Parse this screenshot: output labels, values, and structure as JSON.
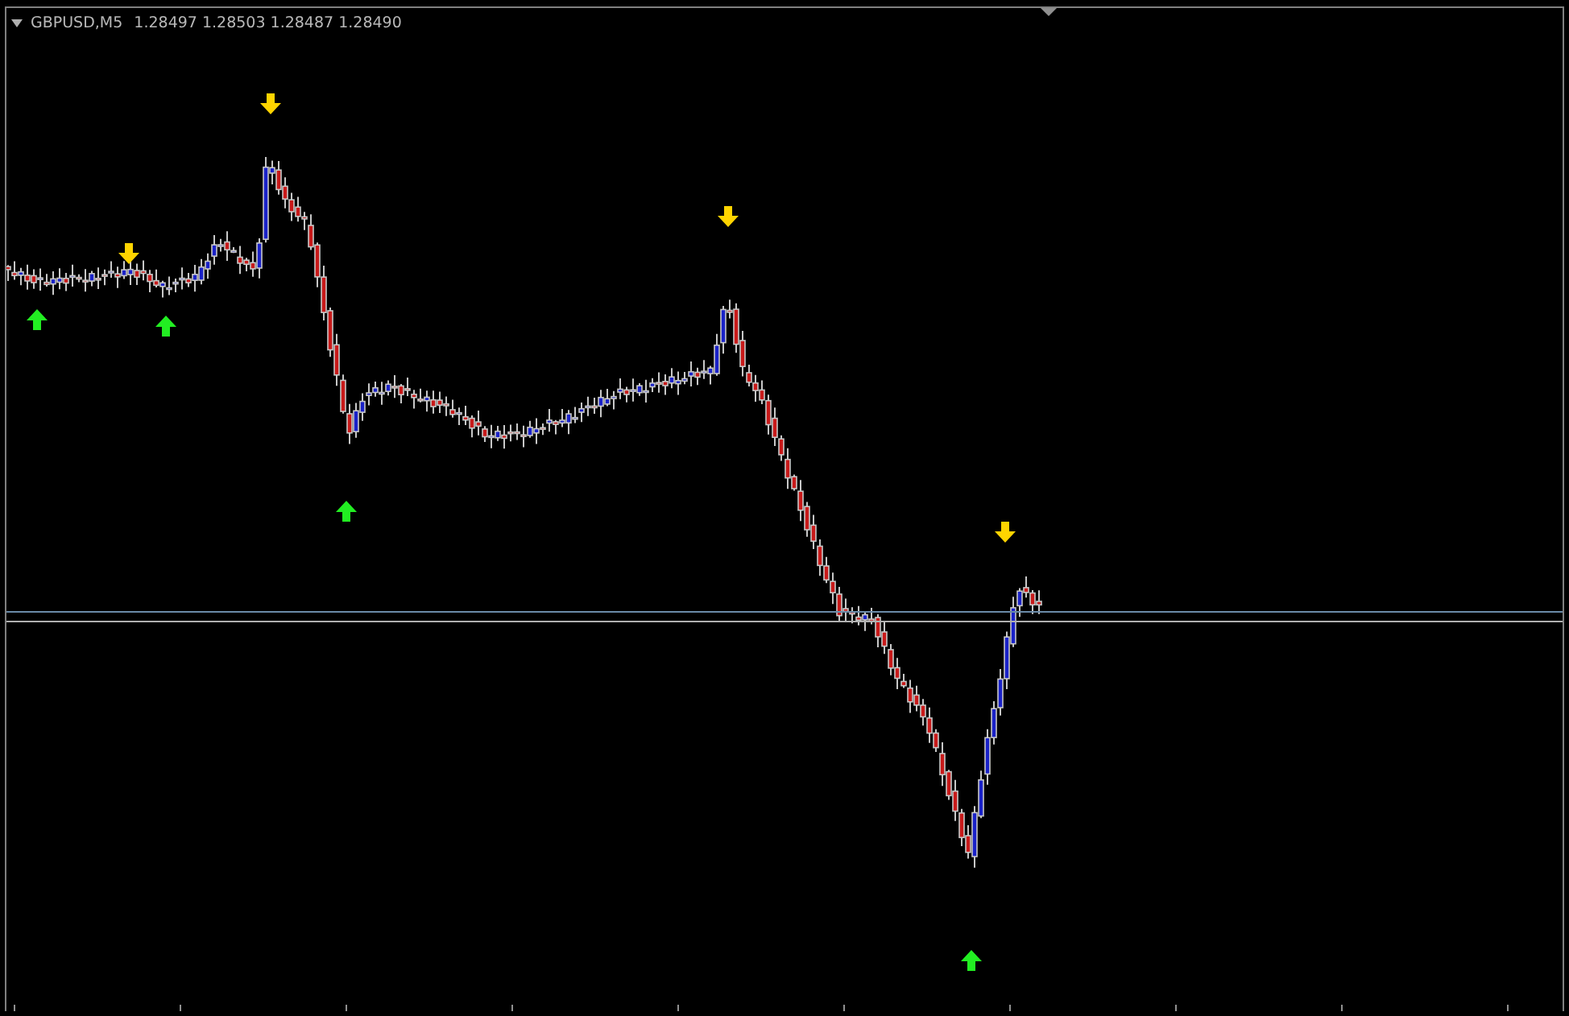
{
  "chart": {
    "symbol": "GBPUSD,M5",
    "quote": "1.28497 1.28503 1.28487 1.28490"
  }
}
